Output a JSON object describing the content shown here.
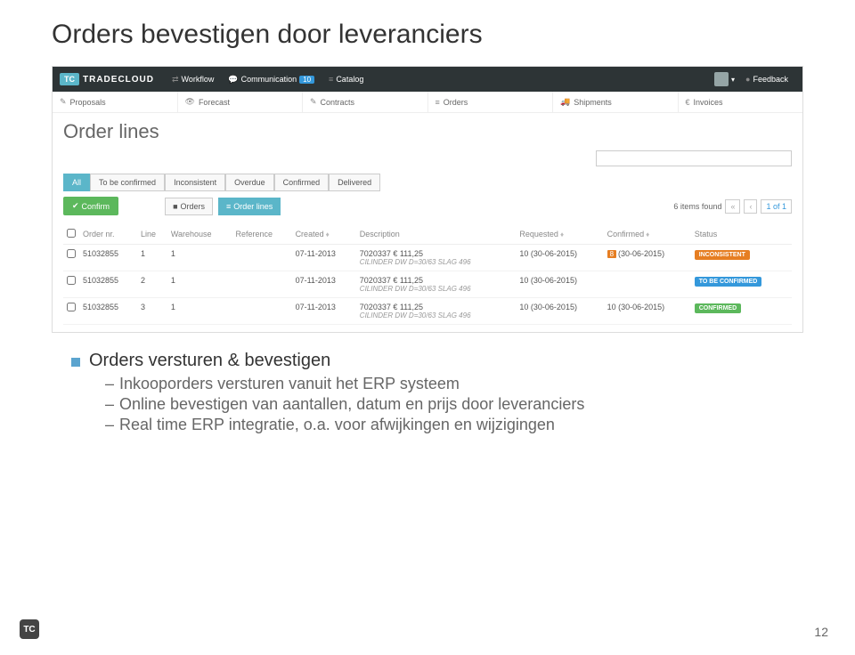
{
  "slide": {
    "title": "Orders bevestigen door leveranciers",
    "page_num": "12",
    "corner_logo": "TC"
  },
  "topbar": {
    "logo": "TC",
    "brand": "TRADECLOUD",
    "workflow": "Workflow",
    "communication": "Communication",
    "comm_badge": "10",
    "catalog": "Catalog",
    "feedback": "Feedback"
  },
  "subnav": {
    "proposals": "Proposals",
    "forecast": "Forecast",
    "contracts": "Contracts",
    "orders": "Orders",
    "shipments": "Shipments",
    "invoices": "Invoices"
  },
  "page": {
    "title": "Order lines"
  },
  "filters": {
    "all": "All",
    "tobe": "To be confirmed",
    "inconsistent": "Inconsistent",
    "overdue": "Overdue",
    "confirmed": "Confirmed",
    "delivered": "Delivered"
  },
  "actions": {
    "confirm": "Confirm",
    "orders_view": "Orders",
    "lines_view": "Order lines"
  },
  "pager": {
    "found": "6 items found",
    "pos": "1 of 1"
  },
  "headers": {
    "ordernr": "Order nr.",
    "line": "Line",
    "warehouse": "Warehouse",
    "reference": "Reference",
    "created": "Created",
    "description": "Description",
    "requested": "Requested",
    "confirmed": "Confirmed",
    "status": "Status"
  },
  "rows": [
    {
      "ordernr": "51032855",
      "line": "1",
      "wh": "1",
      "ref": "",
      "created": "07-11-2013",
      "desc": "7020337  € 111,25",
      "desc2": "CILINDER DW D=30/63 SLAG 496",
      "req": "10  (30-06-2015)",
      "conf_badge": "8",
      "conf": "(30-06-2015)",
      "status": "INCONSISTENT",
      "status_cls": "status-inconsistent"
    },
    {
      "ordernr": "51032855",
      "line": "2",
      "wh": "1",
      "ref": "",
      "created": "07-11-2013",
      "desc": "7020337  € 111,25",
      "desc2": "CILINDER DW D=30/63 SLAG 496",
      "req": "10  (30-06-2015)",
      "conf_badge": "",
      "conf": "",
      "status": "TO BE CONFIRMED",
      "status_cls": "status-tobe"
    },
    {
      "ordernr": "51032855",
      "line": "3",
      "wh": "1",
      "ref": "",
      "created": "07-11-2013",
      "desc": "7020337  € 111,25",
      "desc2": "CILINDER DW D=30/63 SLAG 496",
      "req": "10  (30-06-2015)",
      "conf_badge": "",
      "conf": "10  (30-06-2015)",
      "status": "CONFIRMED",
      "status_cls": "status-confirmed"
    }
  ],
  "bullets": {
    "main": "Orders versturen & bevestigen",
    "sub1": "Inkooporders versturen vanuit het ERP systeem",
    "sub2": "Online bevestigen van aantallen, datum en prijs door leveranciers",
    "sub3": "Real time ERP integratie, o.a. voor afwijkingen en wijzigingen"
  }
}
